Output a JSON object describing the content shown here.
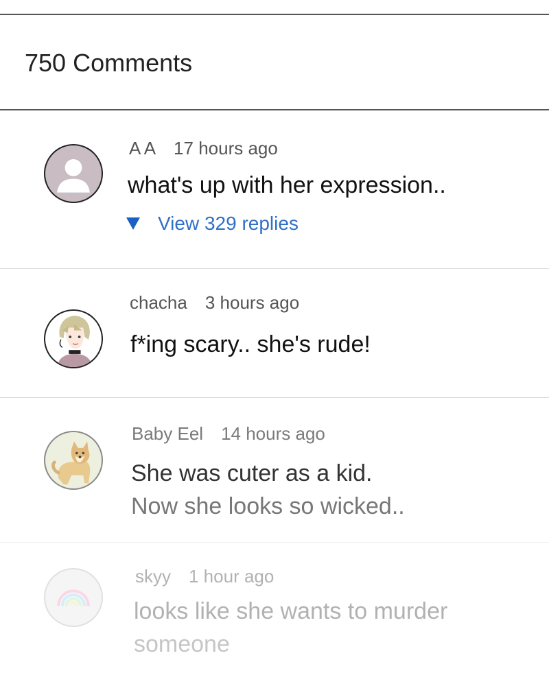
{
  "header": {
    "title": "750 Comments"
  },
  "comments": [
    {
      "author": "A A",
      "time": "17 hours ago",
      "text": "what's up with her expression..",
      "replies_label": "View 329 replies",
      "avatar_icon": "default-user-icon"
    },
    {
      "author": "chacha",
      "time": "3 hours ago",
      "text": "f*ing scary.. she's rude!",
      "avatar_icon": "anime-character-avatar"
    },
    {
      "author": "Baby Eel",
      "time": "14 hours ago",
      "text_lines": [
        "She was cuter as a kid.",
        "Now she looks so wicked.."
      ],
      "avatar_icon": "dog-avatar"
    },
    {
      "author": "skyy",
      "time": "1 hour ago",
      "text_lines": [
        "looks like she wants to murder",
        "someone"
      ],
      "avatar_icon": "rainbow-avatar"
    }
  ],
  "colors": {
    "link": "#2f6fc6",
    "divider": "#dcdcdc",
    "rule": "#555555"
  }
}
